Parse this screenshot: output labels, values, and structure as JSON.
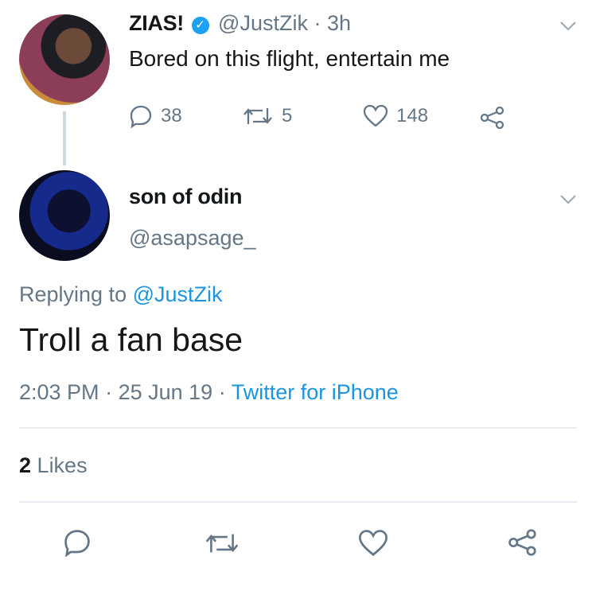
{
  "tweet1": {
    "name": "ZIAS!",
    "handle": "@JustZik",
    "sep": "·",
    "time": "3h",
    "text": "Bored on this flight, entertain me",
    "replies": "38",
    "retweets": "5",
    "likes": "148"
  },
  "tweet2": {
    "name": "son of odin",
    "handle": "@asapsage_",
    "replying_prefix": "Replying to",
    "replying_handle": "@JustZik",
    "text": "Troll a fan base",
    "time": "2:03 PM",
    "sep1": "·",
    "date": "25 Jun 19",
    "sep2": "·",
    "source": "Twitter for iPhone",
    "likes_count": "2",
    "likes_label": "Likes"
  },
  "icons": {
    "reply": "reply-icon",
    "retweet": "retweet-icon",
    "like": "heart-icon",
    "share": "share-icon",
    "more": "chevron-down-icon",
    "verified": "verified-badge-icon"
  },
  "colors": {
    "link": "#1b95e0",
    "muted": "#657786",
    "verified": "#1da1f2",
    "divider": "#e6ecf0"
  }
}
